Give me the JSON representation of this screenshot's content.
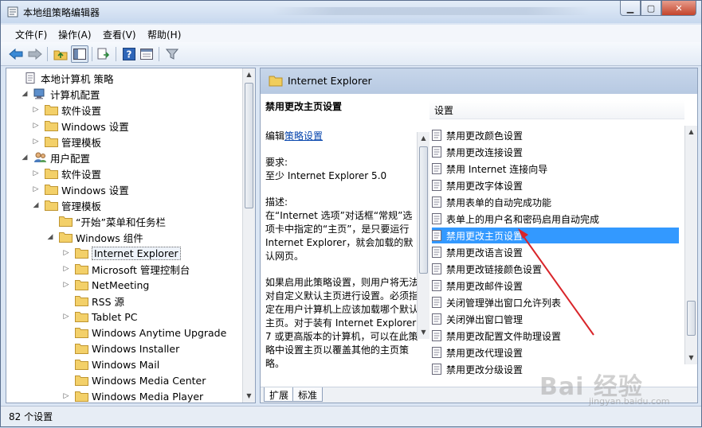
{
  "window": {
    "title": "本地组策略编辑器",
    "controls": {
      "minimize": "▁",
      "maximize": "▢",
      "close": "✕"
    }
  },
  "menu": [
    "文件(F)",
    "操作(A)",
    "查看(V)",
    "帮助(H)"
  ],
  "toolbar": {
    "icons": [
      "back-arrow-icon",
      "forward-arrow-icon",
      "up-folder-icon",
      "show-hide-tree-icon",
      "export-list-icon",
      "help-icon",
      "properties-icon",
      "filter-icon"
    ]
  },
  "tree": {
    "items": [
      {
        "label": "本地计算机 策略",
        "toggle": "",
        "icon": "policy-doc-icon",
        "depth": 0
      },
      {
        "label": "计算机配置",
        "toggle": "◢",
        "icon": "computer-icon",
        "depth": 1
      },
      {
        "label": "软件设置",
        "toggle": "▷",
        "icon": "folder-icon",
        "depth": 2
      },
      {
        "label": "Windows 设置",
        "toggle": "▷",
        "icon": "folder-icon",
        "depth": 2
      },
      {
        "label": "管理模板",
        "toggle": "▷",
        "icon": "folder-icon",
        "depth": 2
      },
      {
        "label": "用户配置",
        "toggle": "◢",
        "icon": "users-icon",
        "depth": 1
      },
      {
        "label": "软件设置",
        "toggle": "▷",
        "icon": "folder-icon",
        "depth": 2
      },
      {
        "label": "Windows 设置",
        "toggle": "▷",
        "icon": "folder-icon",
        "depth": 2
      },
      {
        "label": "管理模板",
        "toggle": "◢",
        "icon": "folder-icon",
        "depth": 2
      },
      {
        "label": "“开始”菜单和任务栏",
        "toggle": "",
        "icon": "folder-icon",
        "depth": 3
      },
      {
        "label": "Windows 组件",
        "toggle": "◢",
        "icon": "folder-icon",
        "depth": 3
      },
      {
        "label": "Internet Explorer",
        "toggle": "▷",
        "icon": "folder-icon",
        "depth": 4,
        "selected": true
      },
      {
        "label": "Microsoft 管理控制台",
        "toggle": "▷",
        "icon": "folder-icon",
        "depth": 4
      },
      {
        "label": "NetMeeting",
        "toggle": "▷",
        "icon": "folder-icon",
        "depth": 4
      },
      {
        "label": "RSS 源",
        "toggle": "",
        "icon": "folder-icon",
        "depth": 4
      },
      {
        "label": "Tablet PC",
        "toggle": "▷",
        "icon": "folder-icon",
        "depth": 4
      },
      {
        "label": "Windows Anytime Upgrade",
        "toggle": "",
        "icon": "folder-icon",
        "depth": 4
      },
      {
        "label": "Windows Installer",
        "toggle": "",
        "icon": "folder-icon",
        "depth": 4
      },
      {
        "label": "Windows Mail",
        "toggle": "",
        "icon": "folder-icon",
        "depth": 4
      },
      {
        "label": "Windows Media Center",
        "toggle": "",
        "icon": "folder-icon",
        "depth": 4
      },
      {
        "label": "Windows Media Player",
        "toggle": "▷",
        "icon": "folder-icon",
        "depth": 4
      }
    ]
  },
  "right": {
    "header_title": "Internet Explorer",
    "desc": {
      "title": "禁用更改主页设置",
      "edit_prefix": "编辑",
      "edit_link": "策略设置",
      "req_label": "要求:",
      "req_value": "至少 Internet Explorer 5.0",
      "desc_label": "描述:",
      "desc_text": "在“Internet 选项”对话框“常规”选项卡中指定的“主页”，是只要运行 Internet Explorer，就会加载的默认网页。",
      "desc_text2": "如果启用此策略设置，则用户将无法对自定义默认主页进行设置。必须指定在用户计算机上应该加载哪个默认主页。对于装有 Internet Explorer 7 或更高版本的计算机，可以在此策略中设置主页以覆盖其他的主页策略。"
    },
    "list_header": "设置",
    "settings": [
      "禁用更改颜色设置",
      "禁用更改连接设置",
      "禁用 Internet 连接向导",
      "禁用更改字体设置",
      "禁用表单的自动完成功能",
      "表单上的用户名和密码启用自动完成",
      "禁用更改主页设置",
      "禁用更改语言设置",
      "禁用更改链接颜色设置",
      "禁用更改邮件设置",
      "关闭管理弹出窗口允许列表",
      "关闭弹出窗口管理",
      "禁用更改配置文件助理设置",
      "禁用更改代理设置",
      "禁用更改分级设置"
    ],
    "selected_index": 6,
    "tabs": [
      "扩展",
      "标准"
    ]
  },
  "status": "82 个设置",
  "watermark": "Bai 经验",
  "watermark_sub": "jingyan.baidu.com",
  "colors": {
    "selection": "#3399ff",
    "arrow": "#d9252a",
    "link": "#0645ad"
  }
}
